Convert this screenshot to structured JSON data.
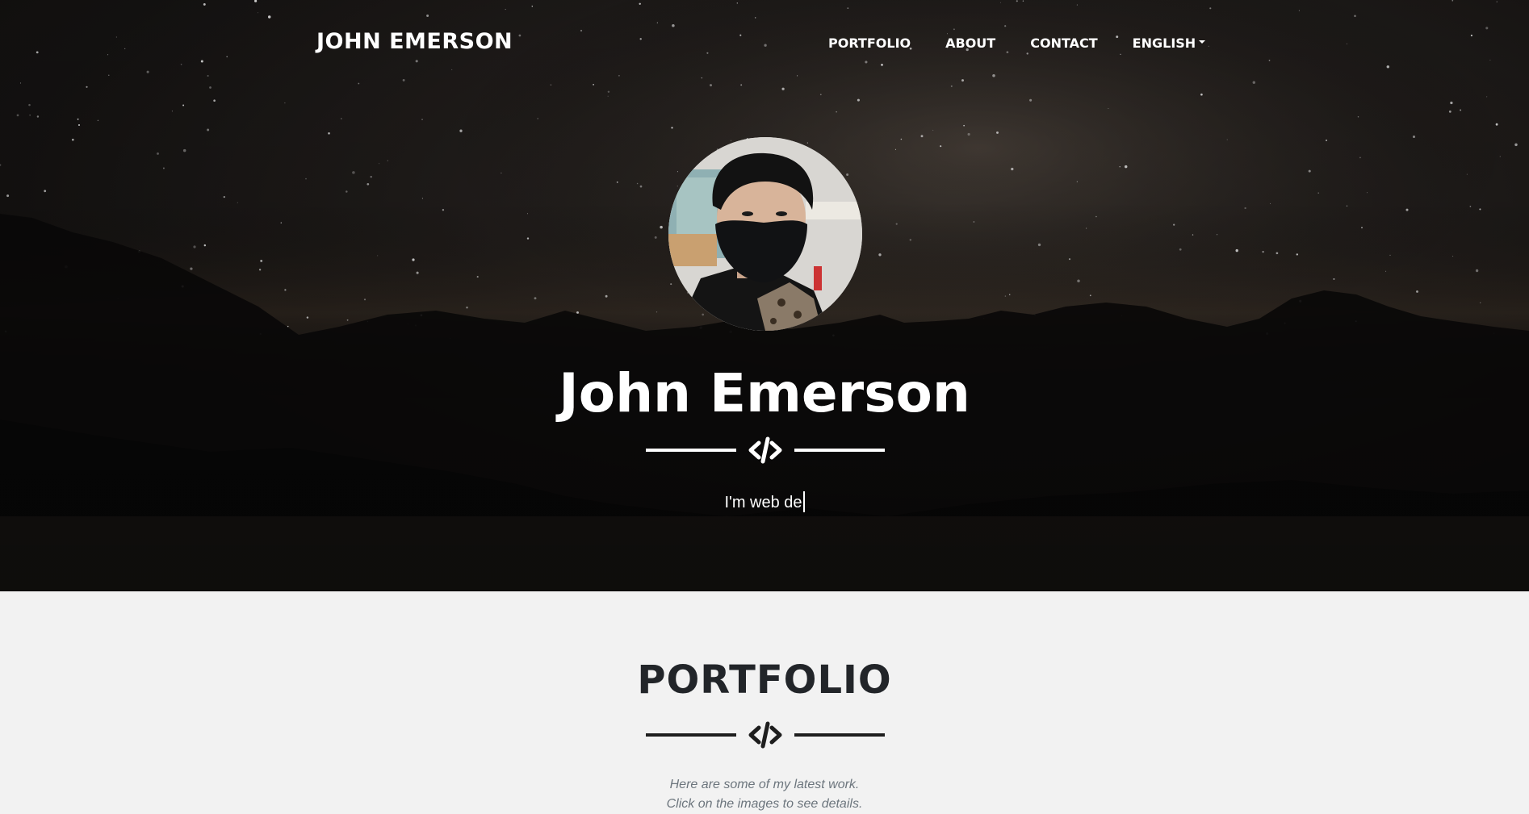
{
  "nav": {
    "brand": "JOHN EMERSON",
    "links": [
      {
        "label": "PORTFOLIO"
      },
      {
        "label": "ABOUT"
      },
      {
        "label": "CONTACT"
      },
      {
        "label": "ENGLISH",
        "dropdown": true
      }
    ]
  },
  "hero": {
    "name": "John Emerson",
    "tagline": "I'm web de",
    "divider_icon": "code-icon",
    "avatar_icon": "profile-photo"
  },
  "portfolio": {
    "title": "PORTFOLIO",
    "divider_icon": "code-icon",
    "intro_line1": "Here are some of my latest work.",
    "intro_line2": "Click on the images to see details."
  },
  "colors": {
    "hero_text": "#ffffff",
    "section_bg": "#f2f2f2",
    "heading_dark": "#222529",
    "muted_text": "#6c757d"
  }
}
